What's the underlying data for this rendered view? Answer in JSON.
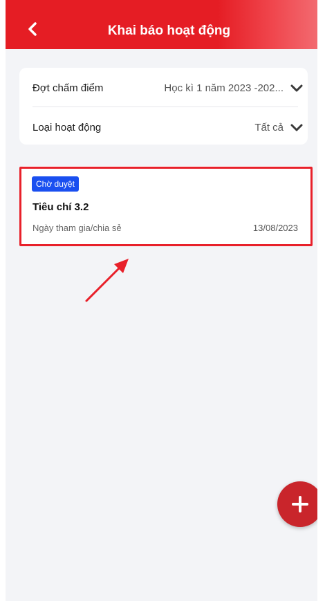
{
  "header": {
    "title": "Khai báo hoạt động",
    "back_icon": "chevron-left-icon"
  },
  "filters": {
    "period_label": "Đợt chấm điểm",
    "period_value": "Học kì 1 năm 2023 -202...",
    "activity_type_label": "Loại hoạt động",
    "activity_type_value": "Tất cả",
    "dropdown_icon": "chevron-down-icon"
  },
  "activities": [
    {
      "status": "Chờ duyệt",
      "title": "Tiêu chí 3.2",
      "date_label": "Ngày tham gia/chia sẻ",
      "date": "13/08/2023"
    }
  ],
  "fab": {
    "icon": "plus-icon"
  },
  "colors": {
    "header_red": "#e51d24",
    "status_blue": "#1a4ff0",
    "fab_red": "#c9252b",
    "annotation_red": "#e8202a"
  }
}
